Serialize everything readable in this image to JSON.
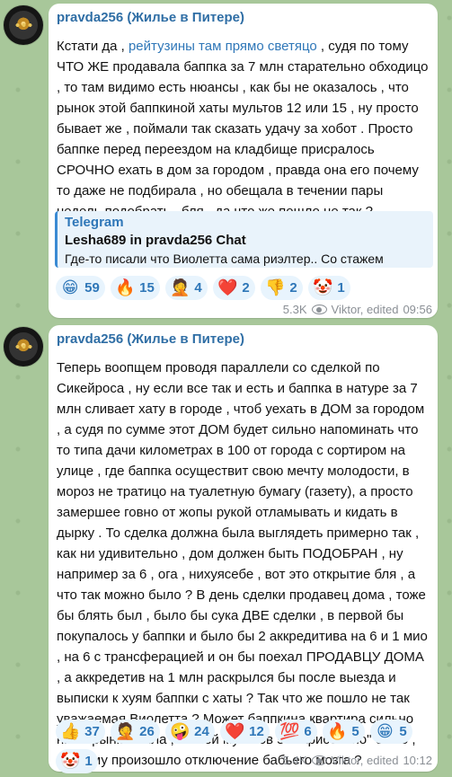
{
  "messages": [
    {
      "sender": "pravda256 (Жилье в Питере)",
      "text_before_link": "Кстати да , ",
      "link": "рейтузины там прямо светяцо",
      "text_after_link": " , судя по тому ЧТО ЖЕ продавала баппка за 7 млн старательно обходицо , то там видимо есть нюансы , как бы не оказалось , что рынок этой баппкиной хаты мультов 12 или 15 , ну просто бывает же , поймали так сказать удачу за хобот . Просто баппке перед переездом на кладбище присралось СРОЧНО ехать в дом за городом , правда она его почему то даже не подбирала , но обещала в течении пары недель подобрать , бля , да что же пошло не так ?",
      "quote": {
        "source": "Telegram",
        "title": "Lesha689 in pravda256 Chat",
        "text": "Где-то писали что Виолетта сама риэлтер.. Со стажем"
      },
      "reactions": [
        {
          "emoji": "😁",
          "count": "59",
          "icon": "grin-emoji-icon"
        },
        {
          "emoji": "🔥",
          "count": "15",
          "icon": "fire-emoji-icon"
        },
        {
          "emoji": "🤦",
          "count": "4",
          "icon": "facepalm-emoji-icon"
        },
        {
          "emoji": "❤️",
          "count": "2",
          "icon": "heart-emoji-icon"
        },
        {
          "emoji": "👎",
          "count": "2",
          "icon": "thumbs-down-emoji-icon"
        },
        {
          "emoji": "🤡",
          "count": "1",
          "icon": "clown-emoji-icon"
        }
      ],
      "views": "5.3K",
      "author": "Viktor, edited",
      "time": "09:56"
    },
    {
      "sender": "pravda256 (Жилье в Питере)",
      "text": "Теперь воопщем проводя параллели со сделкой по Сикейроса , ну если все так и есть и баппка в натуре за 7 млн сливает хату в городе , чтоб уехать в ДОМ за городом , а судя по сумме этот ДОМ будет сильно напоминать что то типа дачи километрах в 100 от города с сортиром на улице , где баппка осуществит свою мечту молодости, в мороз не тратицо на туалетную бумагу (газету), а просто замершее говно от жопы рукой отламывать и кидать в дырку . То сделка должна была выглядеть примерно так , как ни удивительно , дом должен быть ПОДОБРАН , ну например за 6 , ога , нихуясебе , вот это открытие бля , а что так можно было ? В день сделки продавец дома , тоже бы блять был , было бы сука ДВЕ сделки , в первой бы покупалось у баппки и было бы 2 аккредитива на 6 и 1 мио , на 6 с трансферацией и он бы поехал ПРОДАВЦУ ДОМА , а аккредетив на 1 млн раскрылся бы после выезда и выписки к хуям баппки с хаты ? Так что же пошло не так уважаемая Виолетта ? Может баппкина квартира сильно ниже рынка была , на ней мультов 5 \"нарисовано\" было , поэтому произошло отключение бабьего мозга ?",
      "reactions": [
        {
          "emoji": "👍",
          "count": "37",
          "icon": "thumbs-up-emoji-icon"
        },
        {
          "emoji": "🤦",
          "count": "26",
          "icon": "facepalm-emoji-icon"
        },
        {
          "emoji": "🤪",
          "count": "24",
          "icon": "zany-face-emoji-icon"
        },
        {
          "emoji": "❤️",
          "count": "12",
          "icon": "heart-emoji-icon"
        },
        {
          "emoji": "💯",
          "count": "6",
          "icon": "hundred-points-emoji-icon"
        },
        {
          "emoji": "🔥",
          "count": "5",
          "icon": "fire-emoji-icon"
        },
        {
          "emoji": "😁",
          "count": "5",
          "icon": "grin-emoji-icon"
        },
        {
          "emoji": "🤡",
          "count": "1",
          "icon": "clown-emoji-icon"
        }
      ],
      "views": "5.4K",
      "author": "Viktor, edited",
      "time": "10:12"
    }
  ]
}
